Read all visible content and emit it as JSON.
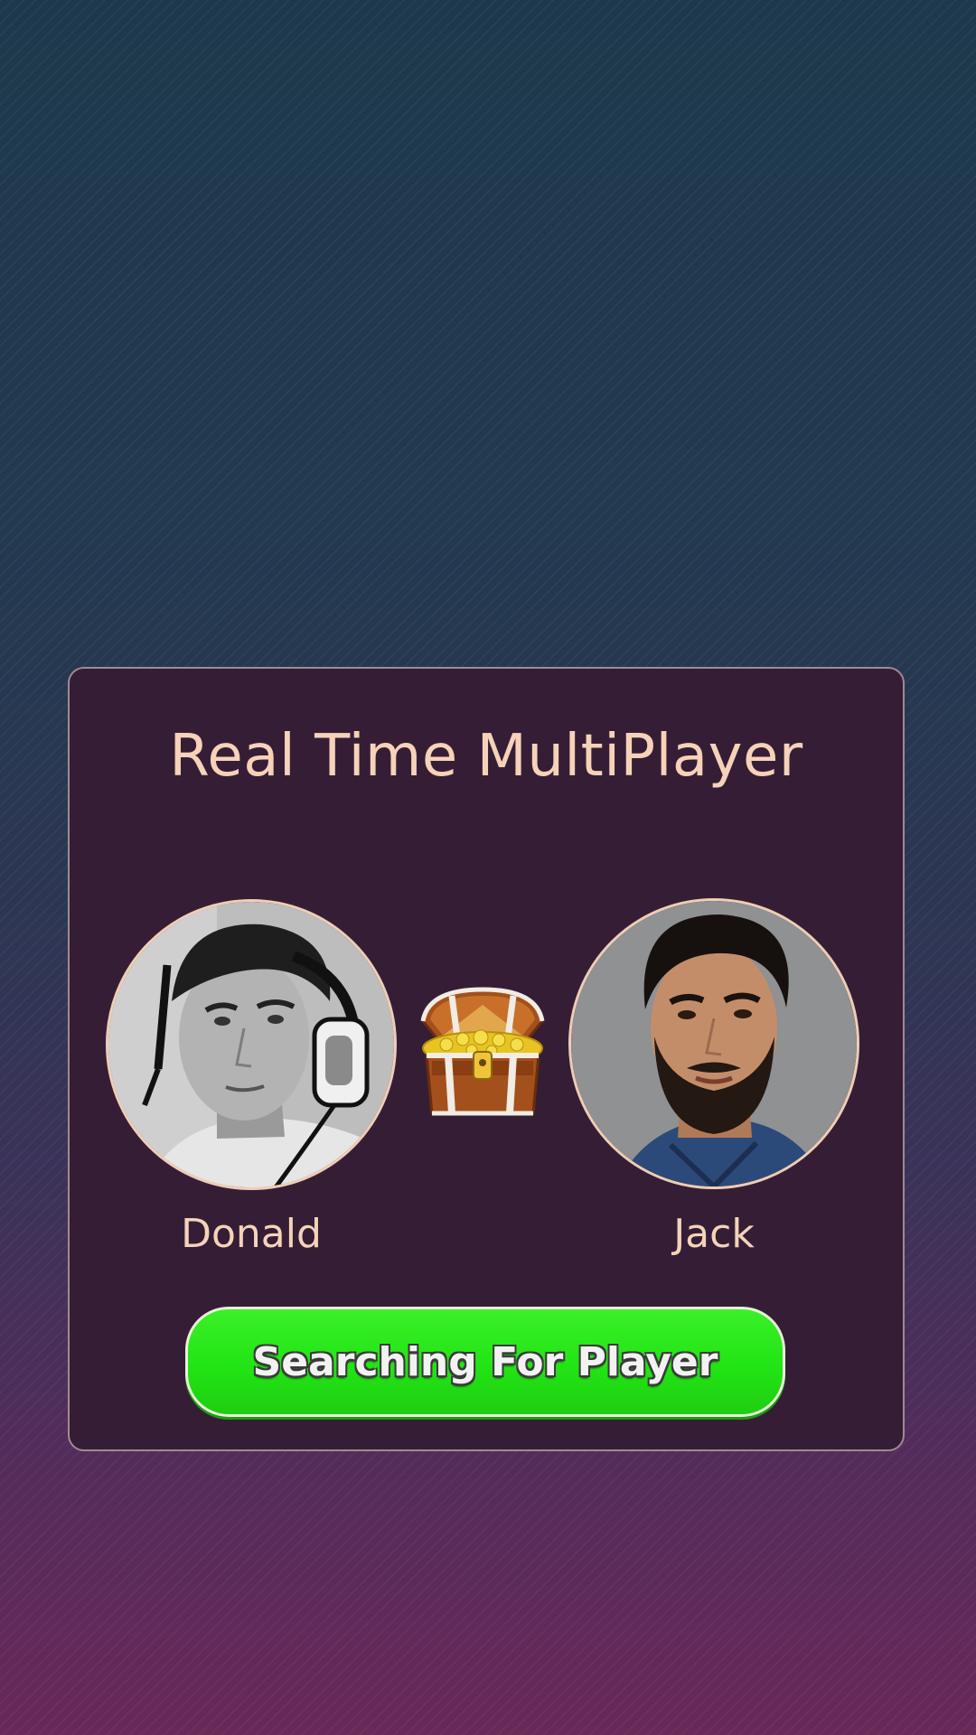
{
  "panel": {
    "title": "Real Time MultiPlayer"
  },
  "players": [
    {
      "name": "Donald",
      "avatar_icon": "player-photo-grayscale"
    },
    {
      "name": "Jack",
      "avatar_icon": "player-photo-color"
    }
  ],
  "prize_icon": "treasure-chest-icon",
  "actions": {
    "search_label": "Searching For Player"
  },
  "colors": {
    "panel_bg": "#351e35",
    "title_text": "#f6d2b9",
    "button_green": "#22e414",
    "background_top": "#1d384c",
    "background_bottom": "#682858"
  }
}
